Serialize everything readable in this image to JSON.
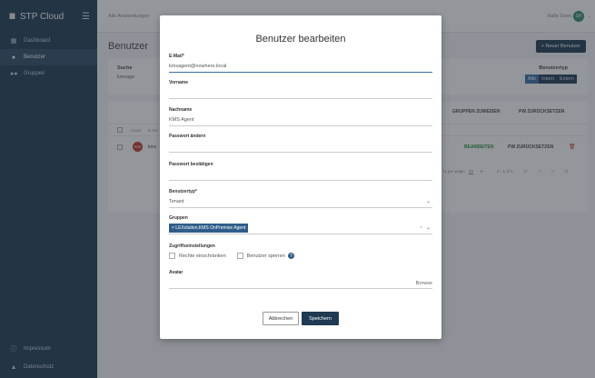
{
  "app": {
    "logo": "IIII",
    "title": "STP Cloud"
  },
  "sidebar": {
    "items": [
      {
        "label": "Dashboard",
        "icon": "grid-icon"
      },
      {
        "label": "Benutzer",
        "icon": "user-icon"
      },
      {
        "label": "Gruppen",
        "icon": "users-icon"
      }
    ],
    "bottom": [
      {
        "label": "Impressum",
        "icon": "info-icon"
      },
      {
        "label": "Datenschutz",
        "icon": "lock-icon"
      }
    ]
  },
  "topbar": {
    "breadcrumb": "Alle Anwendungen",
    "greeting": "Hallo Sven",
    "avatar": "SH"
  },
  "page": {
    "title": "Benutzer",
    "new_user": "+ Neuer Benutzer",
    "search_label": "Suche",
    "search_value": "kmsage",
    "type_label": "Benutzertyp",
    "type_options": [
      "Alle",
      "Intern",
      "Extern"
    ],
    "actions": {
      "assign_groups": "GRUPPEN ZUWEISEN",
      "reset_pw": "PW ZURÜCKSETZEN"
    },
    "table_head": [
      "Avatar",
      "E-Ma"
    ],
    "row": {
      "avatar": "KM",
      "text": "kms",
      "edit": "BEARBEITEN",
      "reset": "PW ZURÜCKSETZEN"
    },
    "pager": {
      "per_page_label": "rs per page:",
      "per_page": "25",
      "range": "1 - 1 of 1"
    }
  },
  "modal": {
    "title": "Benutzer bearbeiten",
    "email_label": "E-Mail*",
    "email_value": "kmsagent@nowhere.local",
    "first_name_label": "Vorname",
    "first_name_value": "",
    "last_name_label": "Nachname",
    "last_name_value": "KMS Agent",
    "pw_change_label": "Passwort ändern",
    "pw_confirm_label": "Passwort bestätigen",
    "type_label": "Benutzertyp*",
    "type_value": "Tenant",
    "groups_label": "Gruppen",
    "group_chip": "× LEXolution.KMS OnPremise Agent",
    "access_label": "Zugriffseinstellungen",
    "restrict_label": "Rechte einschränken",
    "lock_label": "Benutzer sperren",
    "avatar_label": "Avatar",
    "browse_label": "Browse",
    "cancel": "Abbrechen",
    "save": "Speichern"
  },
  "colors": {
    "sidebar": "#1f3a52",
    "primary": "#1f3a52",
    "accent": "#3b6fa8",
    "danger": "#c0392b",
    "success": "#2f8f3a"
  }
}
